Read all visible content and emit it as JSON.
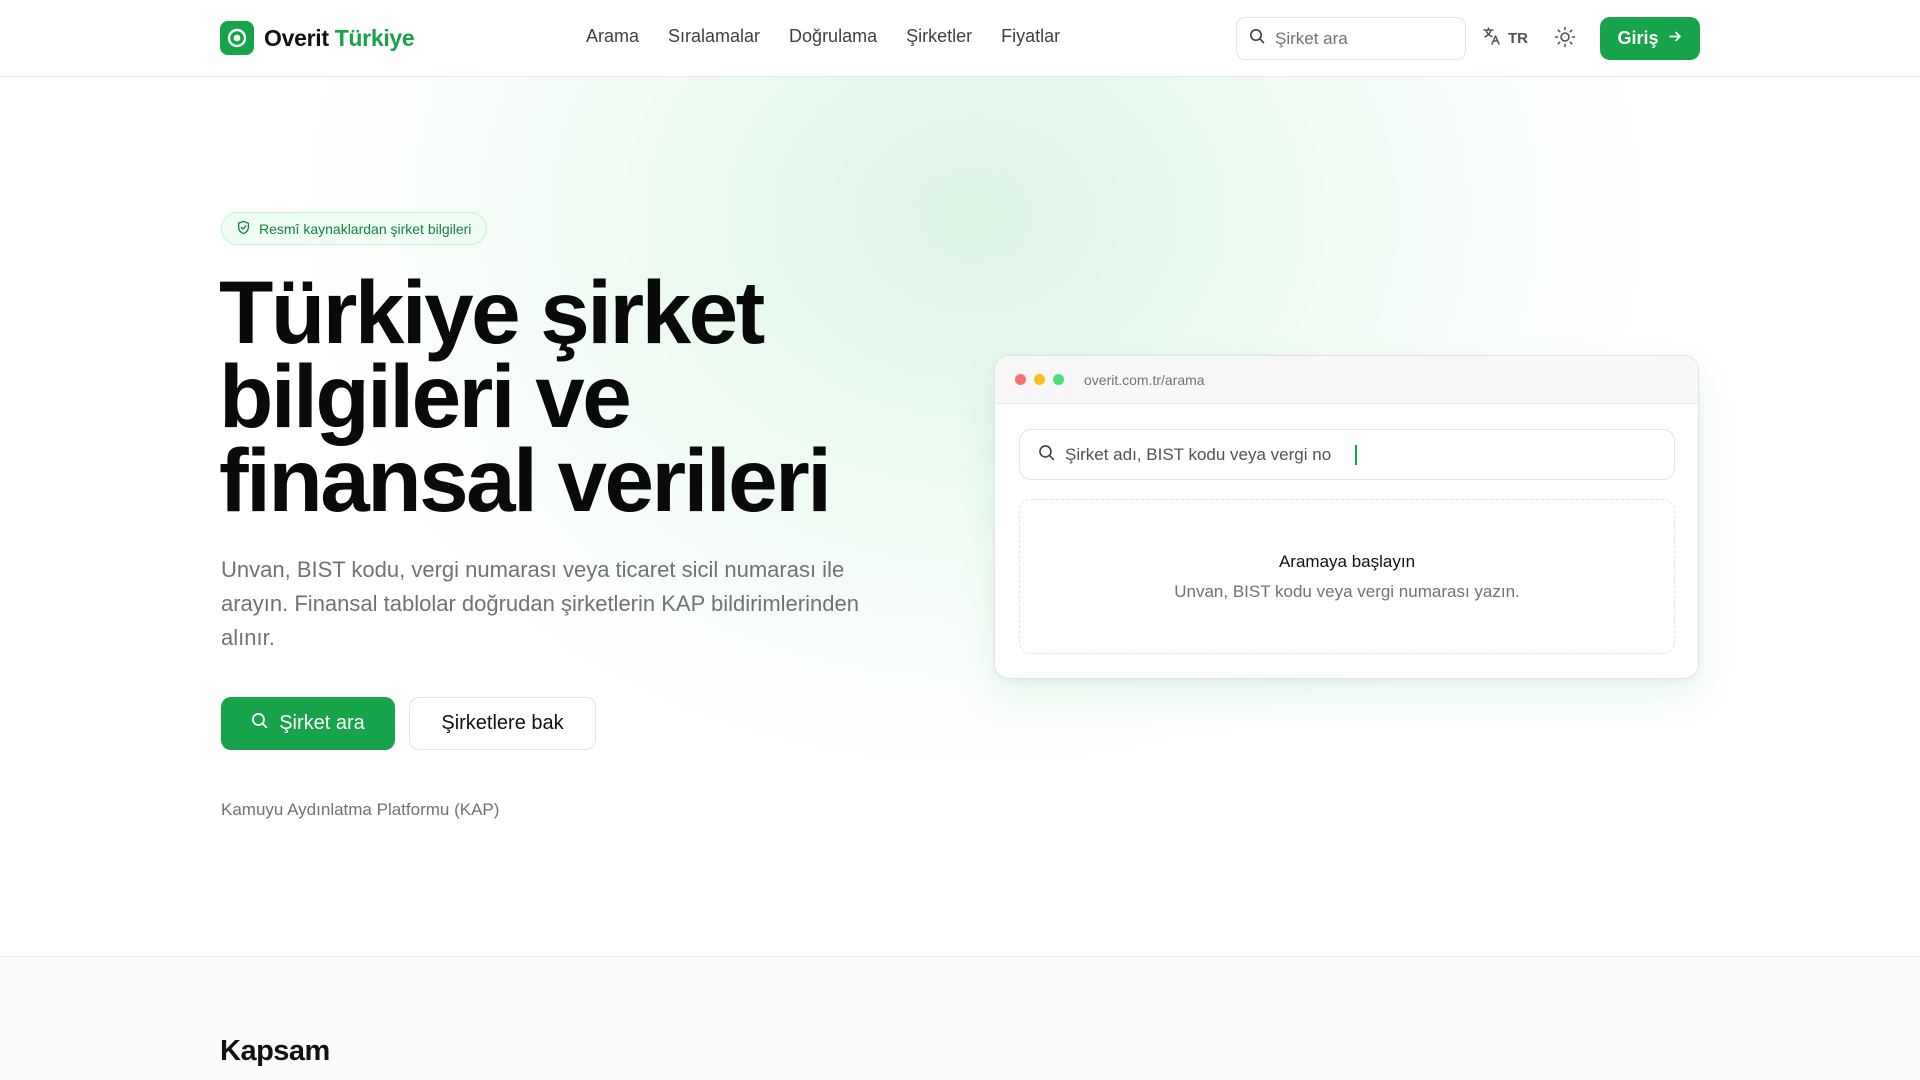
{
  "brand": {
    "name": "Overit",
    "region": "Türkiye"
  },
  "nav": [
    "Arama",
    "Sıralamalar",
    "Doğrulama",
    "Şirketler",
    "Fiyatlar"
  ],
  "header_search": {
    "placeholder": "Şirket ara"
  },
  "language": {
    "code": "TR"
  },
  "login": {
    "label": "Giriş"
  },
  "hero": {
    "badge": "Resmî kaynaklardan şirket bilgileri",
    "title_lines": [
      "Türkiye şirket",
      "bilgileri ve",
      "finansal verileri"
    ],
    "subtitle": "Unvan, BIST kodu, vergi numarası veya ticaret sicil numarası ile arayın. Finansal tablolar doğrudan şirketlerin KAP bildirimlerinden alınır.",
    "primary_button": "Şirket ara",
    "secondary_button": "Şirketlere bak",
    "source_note": "Kamuyu Aydınlatma Platformu (KAP)"
  },
  "mockup": {
    "url": "overit.com.tr/arama",
    "search_placeholder": "Şirket adı, BIST kodu veya vergi no",
    "empty_title": "Aramaya başlayın",
    "empty_desc": "Unvan, BIST kodu veya vergi numarası yazın."
  },
  "coverage": {
    "title": "Kapsam"
  },
  "colors": {
    "accent": "#16a34a",
    "dot_red": "#f87171",
    "dot_yellow": "#fbbf24",
    "dot_green": "#4ade80"
  }
}
